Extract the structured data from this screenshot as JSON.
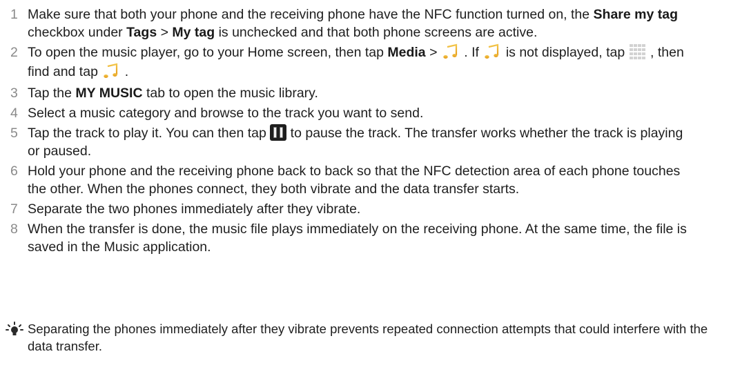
{
  "steps": [
    {
      "num": "1",
      "parts": [
        "Make sure that both your phone and the receiving phone have the NFC function turned on, the ",
        "Share my tag",
        " checkbox under ",
        "Tags",
        " > ",
        "My tag",
        " is unchecked and that both phone screens are active."
      ]
    },
    {
      "num": "2",
      "parts": [
        "To open the music player, go to your Home screen, then tap ",
        "Media",
        " > ",
        " . If ",
        " is not displayed, tap ",
        " , then find and tap ",
        " ."
      ]
    },
    {
      "num": "3",
      "parts": [
        "Tap the ",
        "MY MUSIC",
        " tab to open the music library."
      ]
    },
    {
      "num": "4",
      "parts": [
        "Select a music category and browse to the track you want to send."
      ]
    },
    {
      "num": "5",
      "parts": [
        "Tap the track to play it. You can then tap ",
        " to pause the track. The transfer works whether the track is playing or paused."
      ]
    },
    {
      "num": "6",
      "parts": [
        "Hold your phone and the receiving phone back to back so that the NFC detection area of each phone touches the other. When the phones connect, they both vibrate and the data transfer starts."
      ]
    },
    {
      "num": "7",
      "parts": [
        "Separate the two phones immediately after they vibrate."
      ]
    },
    {
      "num": "8",
      "parts": [
        "When the transfer is done, the music file plays immediately on the receiving phone. At the same time, the file is saved in the Music application."
      ]
    }
  ],
  "icons": {
    "music": "music-note-icon",
    "apps": "app-grid-icon",
    "pause": "pause-icon",
    "tip": "lightbulb-tip-icon"
  },
  "tip": {
    "text": "Separating the phones immediately after they vibrate prevents repeated connection attempts that could interfere with the data transfer."
  }
}
